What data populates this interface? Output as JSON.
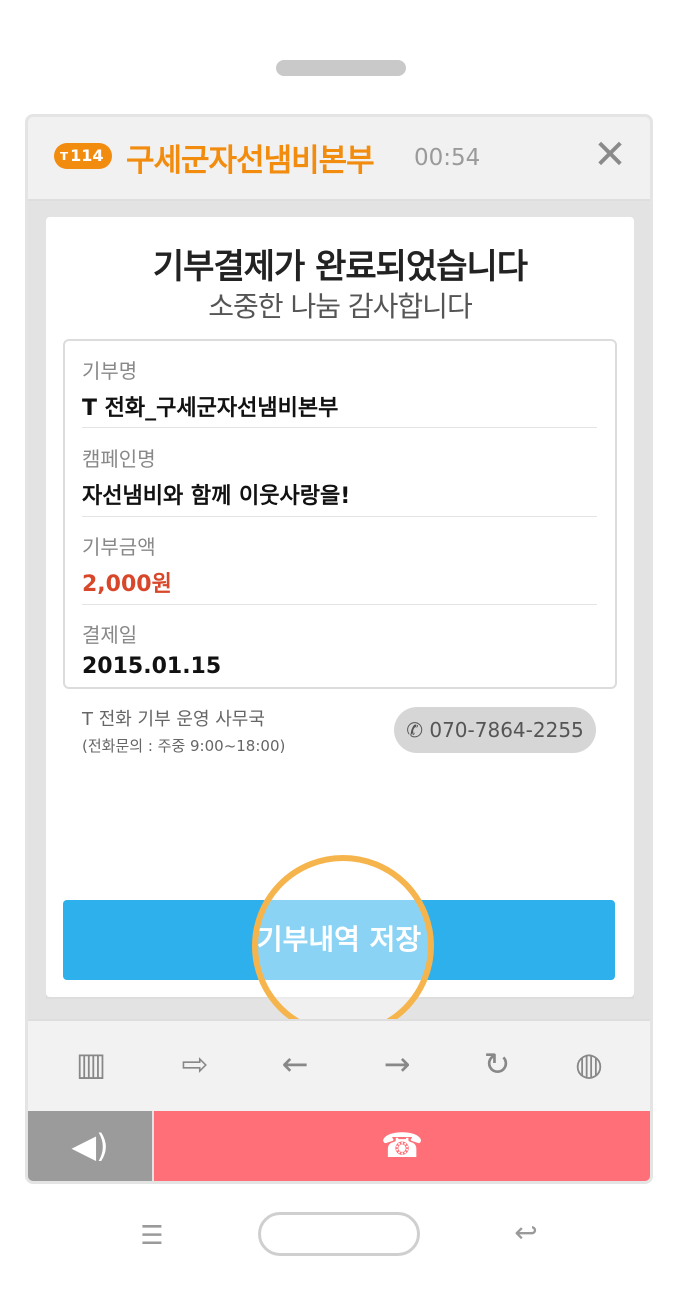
{
  "call": {
    "badge_number": "114",
    "badge_icon": "t-brand-icon",
    "name": "구세군자선냄비본부",
    "timer": "00:54"
  },
  "card": {
    "headline": "기부결제가 완료되었습니다",
    "subline": "소중한 나눔 감사합니다",
    "fields": [
      {
        "label": "기부명",
        "value": "T 전화_구세군자선냄비본부"
      },
      {
        "label": "캠페인명",
        "value": "자선냄비와 함께 이웃사랑을!"
      },
      {
        "label": "기부금액",
        "value": "2,000원"
      },
      {
        "label": "결제일",
        "value": "2015.01.15"
      }
    ],
    "office_name": "T 전화 기부 운영 사무국",
    "office_hours": "(전화문의 : 주중 9:00~18:00)",
    "phone_number": "070-7864-2255",
    "save_button": "기부내역 저장"
  },
  "colors": {
    "accent_orange": "#f28c0f",
    "amount_red": "#d8472a",
    "save_blue": "#2db0ec",
    "end_call_red": "#fe6f77"
  },
  "toolbar_icons": [
    "barcode-icon",
    "share-icon",
    "back-arrow-icon",
    "forward-arrow-icon",
    "refresh-icon",
    "globe-icon"
  ],
  "callbar_icons": [
    "speaker-icon",
    "end-call-icon"
  ],
  "nav_icons": [
    "menu-icon",
    "home-button",
    "back-icon"
  ]
}
